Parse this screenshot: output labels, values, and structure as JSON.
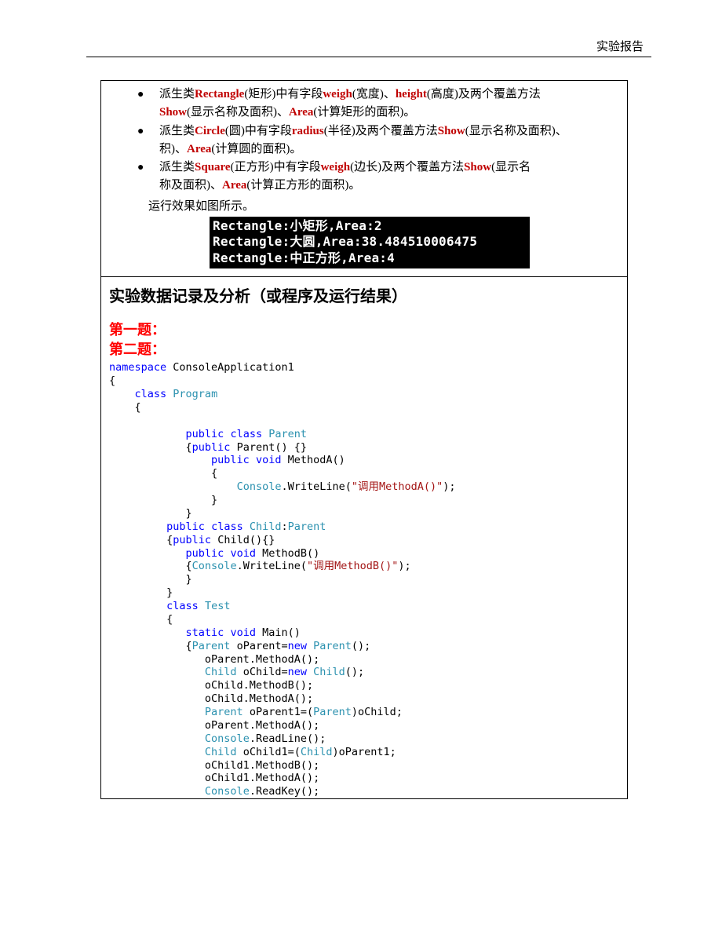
{
  "header": {
    "label": "实验报告"
  },
  "section1": {
    "bullets": [
      {
        "prefix": "派生类",
        "className": "Rectangle",
        "classDesc": "(矩形)中有字段",
        "field1": "weigh",
        "field1Desc": "(宽度)、",
        "field2": "height",
        "field2Desc": "(高度)及两个覆盖方法",
        "m1": "Show",
        "m1Desc": "(显示名称及面积)、",
        "m2": "Area",
        "m2Desc": "(计算矩形的面积)。"
      },
      {
        "prefix": "派生类",
        "className": "Circle",
        "classDesc": "(圆)中有字段",
        "field1": "radius",
        "field1Desc": "(半径)及两个覆盖方法",
        "m1": "Show",
        "m1Desc": "(显示名称及面积)、",
        "m2": "Area",
        "m2Desc": "(计算圆的面积)。"
      },
      {
        "prefix": "派生类",
        "className": "Square",
        "classDesc": "(正方形)中有字段",
        "field1": "weigh",
        "field1Desc": "(边长)及两个覆盖方法",
        "m1": "Show",
        "m1Desc": "(显示名称及面积)、",
        "m2": "Area",
        "m2Desc": "(计算正方形的面积)。"
      }
    ],
    "runNote": "运行效果如图所示。",
    "console": [
      "Rectangle:小矩形,Area:2",
      "Rectangle:大圆,Area:38.484510006475",
      "Rectangle:中正方形,Area:4"
    ]
  },
  "section2": {
    "title": "实验数据记录及分析（或程序及运行结果）",
    "q1": "第一题：",
    "q2": "第二题：",
    "code": {
      "l00a": "namespace",
      "l00b": " ConsoleApplication1",
      "l01": "{",
      "l02a": "    ",
      "l02b": "class",
      "l02c": " ",
      "l02d": "Program",
      "l03": "    {",
      "l04": "",
      "l05a": "            ",
      "l05b": "public",
      "l05c": " ",
      "l05d": "class",
      "l05e": " ",
      "l05f": "Parent",
      "l06a": "            {",
      "l06b": "public",
      "l06c": " Parent() {}",
      "l07a": "                ",
      "l07b": "public",
      "l07c": " ",
      "l07d": "void",
      "l07e": " MethodA()",
      "l08": "                {",
      "l09a": "                    ",
      "l09b": "Console",
      "l09c": ".WriteLine(",
      "l09d": "\"调用MethodA()\"",
      "l09e": ");",
      "l10": "                }",
      "l11": "            }",
      "l12a": "         ",
      "l12b": "public",
      "l12c": " ",
      "l12d": "class",
      "l12e": " ",
      "l12f": "Child",
      "l12g": ":",
      "l12h": "Parent",
      "l13a": "         {",
      "l13b": "public",
      "l13c": " Child(){}",
      "l14a": "            ",
      "l14b": "public",
      "l14c": " ",
      "l14d": "void",
      "l14e": " MethodB()",
      "l15a": "            {",
      "l15b": "Console",
      "l15c": ".WriteLine(",
      "l15d": "\"调用MethodB()\"",
      "l15e": ");",
      "l16": "            }",
      "l17": "         }",
      "l18a": "         ",
      "l18b": "class",
      "l18c": " ",
      "l18d": "Test",
      "l19": "         {",
      "l20a": "            ",
      "l20b": "static",
      "l20c": " ",
      "l20d": "void",
      "l20e": " Main()",
      "l21a": "            {",
      "l21b": "Parent",
      "l21c": " oParent=",
      "l21d": "new",
      "l21e": " ",
      "l21f": "Parent",
      "l21g": "();",
      "l22": "               oParent.MethodA();",
      "l23a": "               ",
      "l23b": "Child",
      "l23c": " oChild=",
      "l23d": "new",
      "l23e": " ",
      "l23f": "Child",
      "l23g": "();",
      "l24": "               oChild.MethodB();",
      "l25": "               oChild.MethodA();",
      "l26a": "               ",
      "l26b": "Parent",
      "l26c": " oParent1=(",
      "l26d": "Parent",
      "l26e": ")oChild;",
      "l27": "               oParent.MethodA();",
      "l28a": "               ",
      "l28b": "Console",
      "l28c": ".ReadLine();",
      "l29a": "               ",
      "l29b": "Child",
      "l29c": " oChild1=(",
      "l29d": "Child",
      "l29e": ")oParent1;",
      "l30": "               oChild1.MethodB();",
      "l31": "               oChild1.MethodA();",
      "l32a": "               ",
      "l32b": "Console",
      "l32c": ".ReadKey();"
    }
  }
}
